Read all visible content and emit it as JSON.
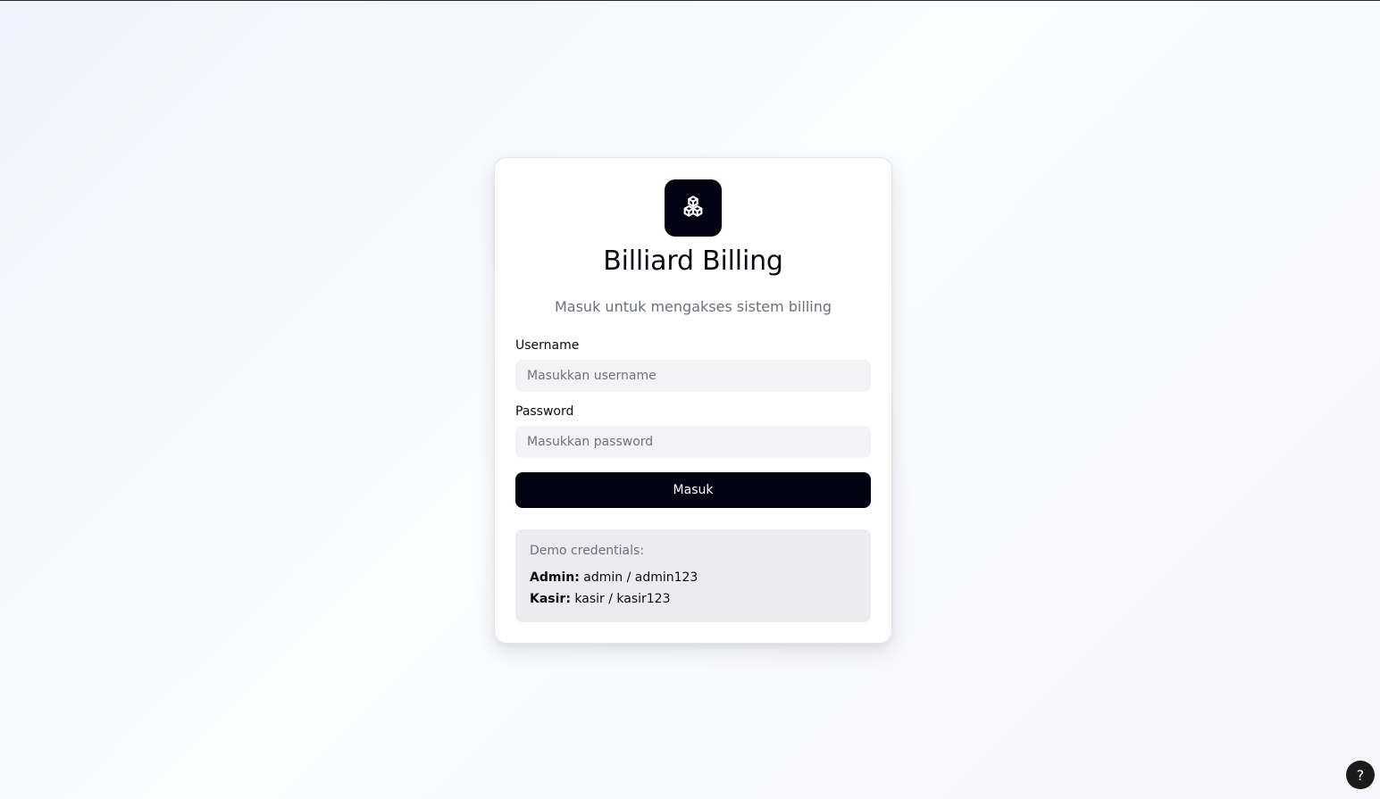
{
  "app": {
    "title": "Billiard Billing",
    "subtitle": "Masuk untuk mengakses sistem billing",
    "logo_icon": "boxes-icon"
  },
  "form": {
    "username_label": "Username",
    "username_placeholder": "Masukkan username",
    "username_value": "",
    "password_label": "Password",
    "password_placeholder": "Masukkan password",
    "password_value": "",
    "submit_label": "Masuk"
  },
  "demo": {
    "title": "Demo credentials:",
    "admin_label": "Admin:",
    "admin_value": "admin / admin123",
    "kasir_label": "Kasir:",
    "kasir_value": "kasir / kasir123"
  },
  "help": {
    "label": "?"
  },
  "colors": {
    "primary": "#030213",
    "input_bg": "#f3f3f5",
    "muted_text": "#6b6f80",
    "demo_bg": "#ececf0"
  }
}
